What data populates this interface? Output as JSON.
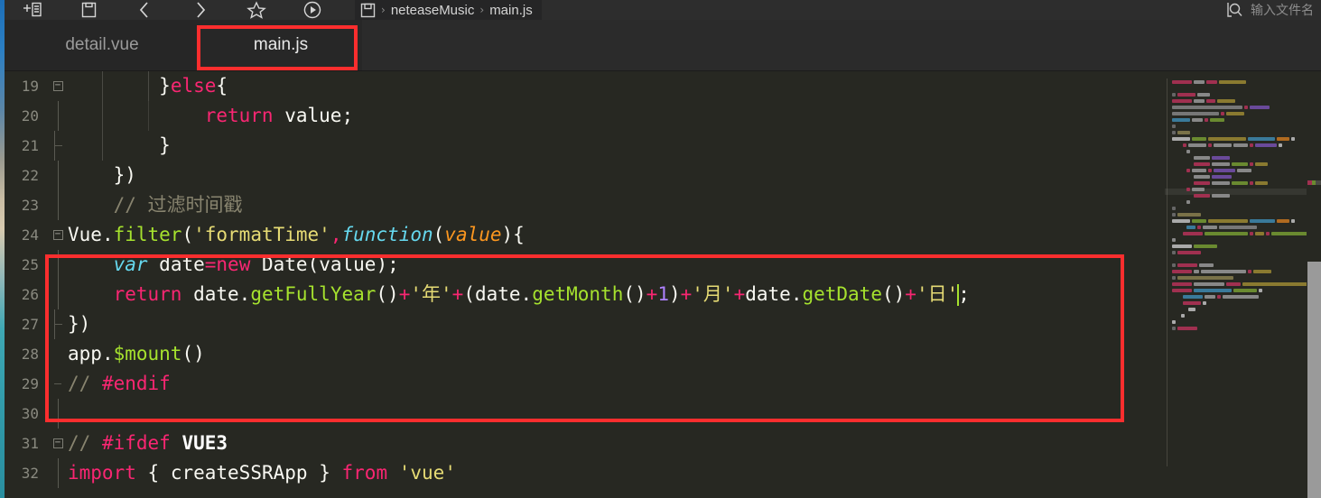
{
  "window": {
    "background_color": "#272822",
    "accent_color": "#fb2e2e"
  },
  "toolbar": {
    "icons": [
      {
        "name": "new-file-icon",
        "glyph": "new-file"
      },
      {
        "name": "save-icon",
        "glyph": "save"
      },
      {
        "name": "back-arrow-icon",
        "glyph": "chevron-left"
      },
      {
        "name": "forward-arrow-icon",
        "glyph": "chevron-right"
      },
      {
        "name": "bookmark-star-icon",
        "glyph": "star"
      },
      {
        "name": "run-icon",
        "glyph": "play-circle"
      }
    ]
  },
  "breadcrumb": {
    "file_icon": "file-icon",
    "separator": "›",
    "project": "neteaseMusic",
    "file": "main.js"
  },
  "search": {
    "icon": "search-icon",
    "placeholder": "输入文件名",
    "value": ""
  },
  "tabs": [
    {
      "label": "detail.vue",
      "active": false
    },
    {
      "label": "main.js",
      "active": true
    }
  ],
  "annotations": [
    {
      "name": "annotation-tab-main-js",
      "target": "main.js tab",
      "color": "#fb2e2e"
    },
    {
      "name": "annotation-code-filter-block",
      "target": "lines 23-27",
      "color": "#fb2e2e"
    }
  ],
  "editor": {
    "language": "javascript",
    "first_visible_line": 19,
    "cursor_line": 26,
    "lines": [
      {
        "number": "19",
        "fold": "open",
        "text": "        }else{"
      },
      {
        "number": "20",
        "fold": "guide",
        "text": "            return value;"
      },
      {
        "number": "21",
        "fold": "end",
        "text": "        }"
      },
      {
        "number": "22",
        "fold": "none",
        "text": "    })"
      },
      {
        "number": "23",
        "fold": "guide",
        "text": "    // 过滤时间戳"
      },
      {
        "number": "24",
        "fold": "open",
        "text": "Vue.filter('formatTime',function(value){"
      },
      {
        "number": "25",
        "fold": "guide",
        "text": "    var date=new Date(value);"
      },
      {
        "number": "26",
        "fold": "guide",
        "text": "    return date.getFullYear()+'年'+(date.getMonth()+1)+'月'+date.getDate()+'日';"
      },
      {
        "number": "27",
        "fold": "end",
        "text": "})"
      },
      {
        "number": "28",
        "fold": "none",
        "text": "app.$mount()"
      },
      {
        "number": "29",
        "fold": "end",
        "text": "// #endif"
      },
      {
        "number": "30",
        "fold": "guide",
        "text": ""
      },
      {
        "number": "31",
        "fold": "open",
        "text": "// #ifdef VUE3"
      },
      {
        "number": "32",
        "fold": "guide",
        "text": "import { createSSRApp } from 'vue'"
      }
    ]
  },
  "minimap": {
    "name": "minimap",
    "visible": true
  },
  "scrollbar": {
    "name": "vertical-scrollbar",
    "thumb_visible": true
  }
}
